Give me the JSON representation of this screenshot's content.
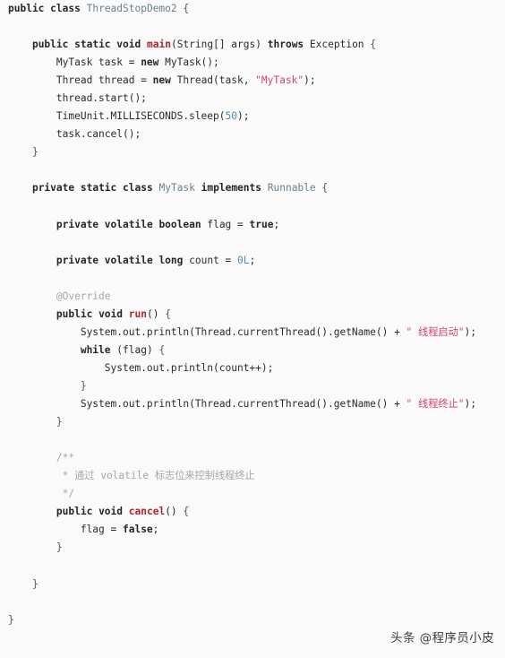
{
  "editor": {
    "language": "java",
    "background_color": "#fafafa",
    "default_text_color": "#2b2b2b",
    "colors": {
      "keyword": "#262626",
      "type": "#6c7f8c",
      "method": "#b0262c",
      "string": "#d4436f",
      "number": "#4a8fa8",
      "comment": "#a6a6a6",
      "annotation": "#a8a8a8",
      "punctuation": "#555555"
    },
    "file_title": "ThreadStopDemo2",
    "lines": [
      "public class ThreadStopDemo2 {",
      "",
      "    public static void main(String[] args) throws Exception {",
      "        MyTask task = new MyTask();",
      "        Thread thread = new Thread(task, \"MyTask\");",
      "        thread.start();",
      "        TimeUnit.MILLISECONDS.sleep(50);",
      "        task.cancel();",
      "    }",
      "",
      "    private static class MyTask implements Runnable {",
      "",
      "        private volatile boolean flag = true;",
      "",
      "        private volatile long count = 0L;",
      "",
      "        @Override",
      "        public void run() {",
      "            System.out.println(Thread.currentThread().getName() + \" 线程启动\");",
      "            while (flag) {",
      "                System.out.println(count++);",
      "            }",
      "            System.out.println(Thread.currentThread().getName() + \" 线程终止\");",
      "        }",
      "",
      "        /**",
      "         * 通过 volatile 标志位来控制线程终止",
      "         */",
      "        public void cancel() {",
      "            flag = false;",
      "        }",
      "",
      "    }",
      "",
      "}"
    ],
    "strings": [
      "MyTask",
      " 线程启动",
      " 线程终止"
    ],
    "numbers": [
      "50",
      "0L"
    ],
    "comment_block": [
      "/**",
      "* 通过 volatile 标志位来控制线程终止",
      "*/"
    ],
    "annotations": [
      "@Override"
    ],
    "keywords": [
      "public",
      "class",
      "static",
      "void",
      "new",
      "private",
      "volatile",
      "boolean",
      "long",
      "true",
      "false",
      "while",
      "implements",
      "throws"
    ],
    "types": [
      "ThreadStopDemo2",
      "MyTask",
      "Runnable"
    ],
    "methods": [
      "main",
      "run",
      "cancel"
    ]
  },
  "watermark": {
    "text": "头条 @程序员小皮"
  }
}
